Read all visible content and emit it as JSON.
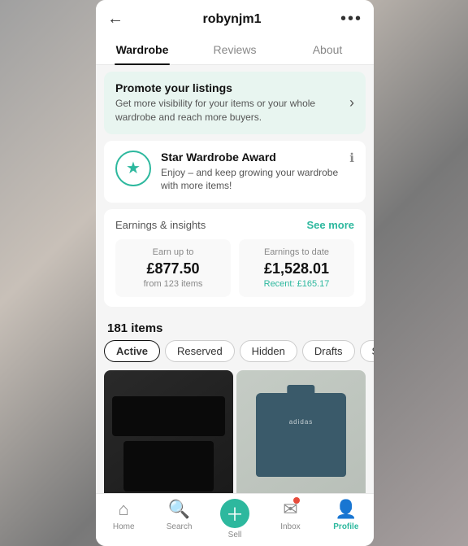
{
  "header": {
    "back_icon": "←",
    "username": "robynjm1",
    "more_icon": "•••"
  },
  "tabs": [
    {
      "label": "Wardrobe",
      "active": true
    },
    {
      "label": "Reviews",
      "active": false
    },
    {
      "label": "About",
      "active": false
    }
  ],
  "promote_banner": {
    "title": "Promote your listings",
    "description": "Get more visibility for your items or your whole wardrobe and reach more buyers.",
    "arrow": "›"
  },
  "star_award": {
    "icon": "★",
    "title": "Star Wardrobe Award",
    "description": "Enjoy – and keep growing your wardrobe with more items!",
    "info_icon": "ℹ"
  },
  "earnings": {
    "label": "Earnings & insights",
    "see_more": "See more",
    "earn_up_to_label": "Earn up to",
    "earn_up_to_amount": "£877.50",
    "earn_up_to_from": "from 123 items",
    "earnings_to_date_label": "Earnings to date",
    "earnings_to_date_amount": "£1,528.01",
    "recent": "Recent: £165.17"
  },
  "items": {
    "count_label": "181 items",
    "filters": [
      {
        "label": "Active",
        "active": true
      },
      {
        "label": "Reserved",
        "active": false
      },
      {
        "label": "Hidden",
        "active": false
      },
      {
        "label": "Drafts",
        "active": false
      },
      {
        "label": "Sold",
        "active": false
      }
    ]
  },
  "bottom_nav": [
    {
      "label": "Home",
      "icon": "⌂",
      "active": false
    },
    {
      "label": "Search",
      "icon": "⌕",
      "active": false
    },
    {
      "label": "Sell",
      "icon": "+",
      "active": false,
      "is_sell": true
    },
    {
      "label": "Inbox",
      "icon": "✉",
      "active": false,
      "has_badge": true
    },
    {
      "label": "Profile",
      "icon": "👤",
      "active": true
    }
  ]
}
